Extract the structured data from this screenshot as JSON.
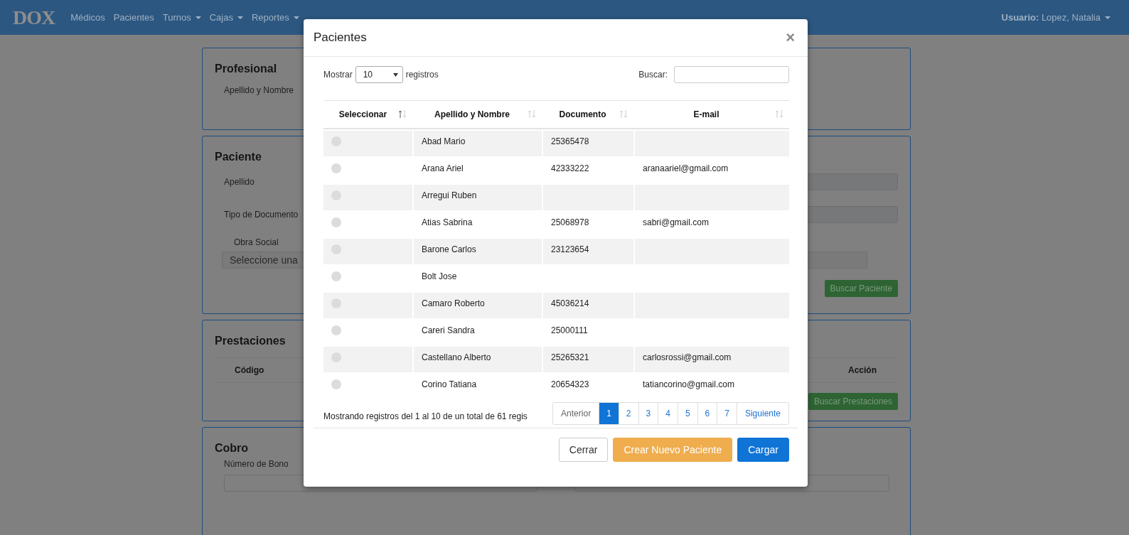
{
  "navbar": {
    "logo": "DOX",
    "links": [
      {
        "label": "Médicos",
        "dropdown": false
      },
      {
        "label": "Pacientes",
        "dropdown": false
      },
      {
        "label": "Turnos",
        "dropdown": true
      },
      {
        "label": "Cajas",
        "dropdown": true
      },
      {
        "label": "Reportes",
        "dropdown": true
      }
    ],
    "user": "**Usuario:** Lopez, Natalia",
    "user_dropdown": true
  },
  "page_cards": [
    {
      "kind": "profesional",
      "title": "Profesional",
      "label": "Apellido y Nombre"
    },
    {
      "kind": "paciente",
      "title": "Paciente",
      "fields": [
        "Apellido",
        "Tipo de Documento"
      ],
      "obra_social_label": "Obra Social",
      "obra_social_value": "Seleccione una",
      "button": "Buscar Paciente"
    },
    {
      "kind": "prestaciones",
      "title": "Prestaciones",
      "columns": [
        "Código",
        "Acción"
      ],
      "button": "Buscar Prestaciones"
    },
    {
      "kind": "cobro",
      "title": "Cobro",
      "label": "Número de Bono"
    }
  ],
  "modal": {
    "title": "Pacientes",
    "close": "×",
    "length_label": "Mostrar",
    "length_value": "10",
    "length_suffix": "registros",
    "search_label": "Buscar:",
    "columns": [
      {
        "label": "Seleccionar",
        "sorted_ascending": true
      },
      {
        "label": "Apellido y Nombre",
        "sorted_ascending": false
      },
      {
        "label": "Documento",
        "sorted_ascending": false
      },
      {
        "label": "E-mail",
        "sorted_ascending": false
      }
    ],
    "rows": [
      {
        "selected": false,
        "name": "Abad Mario",
        "document": "25365478"
      },
      {
        "selected": false,
        "name": "Arana Ariel",
        "document": "42333222",
        "email": "aranaariel@gmail.com"
      },
      {
        "selected": false,
        "name": "Arregui Ruben"
      },
      {
        "selected": false,
        "name": "Atias Sabrina",
        "document": "25068978",
        "email": "sabri@gmail.com"
      },
      {
        "selected": false,
        "name": "Barone Carlos",
        "document": "23123654"
      },
      {
        "selected": false,
        "name": "Bolt Jose"
      },
      {
        "selected": false,
        "name": "Camaro Roberto",
        "document": "45036214"
      },
      {
        "selected": false,
        "name": "Careri Sandra",
        "document": "25000111"
      },
      {
        "selected": false,
        "name": "Castellano Alberto",
        "document": "25265321",
        "email": "carlosrossi@gmail.com"
      },
      {
        "selected": false,
        "name": "Corino Tatiana",
        "document": "20654323",
        "email": "tatiancorino@gmail.com"
      }
    ],
    "info": "Mostrando registros del 1 al 10 de un total de 61 regis",
    "pagination": [
      {
        "label": "Anterior",
        "kind": "nav",
        "disabled": true
      },
      {
        "label": "1",
        "kind": "page",
        "selected": true
      },
      {
        "label": "2",
        "kind": "page",
        "selected": false
      },
      {
        "label": "3",
        "kind": "page",
        "selected": false
      },
      {
        "label": "4",
        "kind": "page",
        "selected": false
      },
      {
        "label": "5",
        "kind": "page",
        "selected": false
      },
      {
        "label": "6",
        "kind": "page",
        "selected": false
      },
      {
        "label": "7",
        "kind": "page",
        "selected": false
      },
      {
        "label": "Siguiente",
        "kind": "nav",
        "disabled": false
      }
    ],
    "buttons": [
      {
        "label": "Cerrar",
        "kind": "default"
      },
      {
        "label": "Crear Nuevo Paciente",
        "kind": "warning"
      },
      {
        "label": "Cargar",
        "kind": "primary"
      }
    ]
  }
}
